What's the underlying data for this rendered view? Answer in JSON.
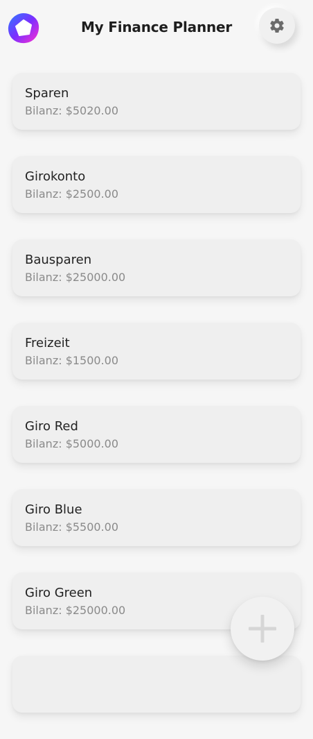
{
  "header": {
    "title": "My Finance Planner",
    "settings_icon": "gear-icon",
    "logo_icon": "app-logo-icon"
  },
  "accounts": [
    {
      "name": "Sparen",
      "balance": "Bilanz: $5020.00"
    },
    {
      "name": "Girokonto",
      "balance": "Bilanz: $2500.00"
    },
    {
      "name": "Bausparen",
      "balance": "Bilanz: $25000.00"
    },
    {
      "name": "Freizeit",
      "balance": "Bilanz: $1500.00"
    },
    {
      "name": "Giro Red",
      "balance": "Bilanz: $5000.00"
    },
    {
      "name": "Giro Blue",
      "balance": "Bilanz: $5500.00"
    },
    {
      "name": "Giro Green",
      "balance": "Bilanz: $25000.00"
    },
    {
      "name": "",
      "balance": ""
    }
  ],
  "fab": {
    "icon": "plus-icon"
  },
  "colors": {
    "background": "#f6f6f6",
    "card": "#efefef",
    "logo_gradient_start": "#2f7bff",
    "logo_gradient_end": "#ff2fd0"
  }
}
